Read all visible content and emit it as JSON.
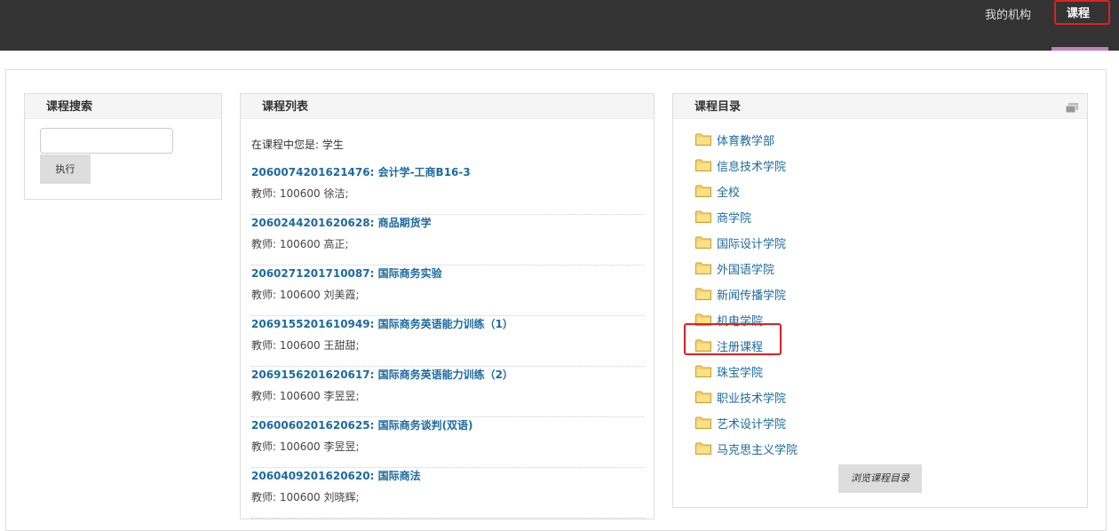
{
  "nav": {
    "my_org": "我的机构",
    "courses": "课程"
  },
  "search": {
    "title": "课程搜索",
    "input_value": "",
    "go_label": "执行"
  },
  "course_list": {
    "title": "课程列表",
    "role_line": "在课程中您是: 学生",
    "items": [
      {
        "title": "2060074201621476: 会计学-工商B16-3",
        "teacher": "教师: 100600 徐洁;"
      },
      {
        "title": "2060244201620628: 商品期货学",
        "teacher": "教师: 100600 高正;"
      },
      {
        "title": "2060271201710087: 国际商务实验",
        "teacher": "教师: 100600 刘美霞;"
      },
      {
        "title": "2069155201610949: 国际商务英语能力训练（1）",
        "teacher": "教师: 100600 王甜甜;"
      },
      {
        "title": "2069156201620617: 国际商务英语能力训练（2）",
        "teacher": "教师: 100600 李昱昱;"
      },
      {
        "title": "2060060201620625: 国际商务谈判(双语)",
        "teacher": "教师: 100600 李昱昱;"
      },
      {
        "title": "2060409201620620: 国际商法",
        "teacher": "教师: 100600 刘晓辉;"
      }
    ]
  },
  "catalogue": {
    "title": "课程目录",
    "items": [
      "体育教学部",
      "信息技术学院",
      "全校",
      "商学院",
      "国际设计学院",
      "外国语学院",
      "新闻传播学院",
      "机电学院",
      "注册课程",
      "珠宝学院",
      "职业技术学院",
      "艺术设计学院",
      "马克思主义学院"
    ],
    "browse_label": "浏览课程目录"
  },
  "colors": {
    "topbar": "#333333",
    "link": "#1b6aa0",
    "highlight": "#e02020"
  }
}
